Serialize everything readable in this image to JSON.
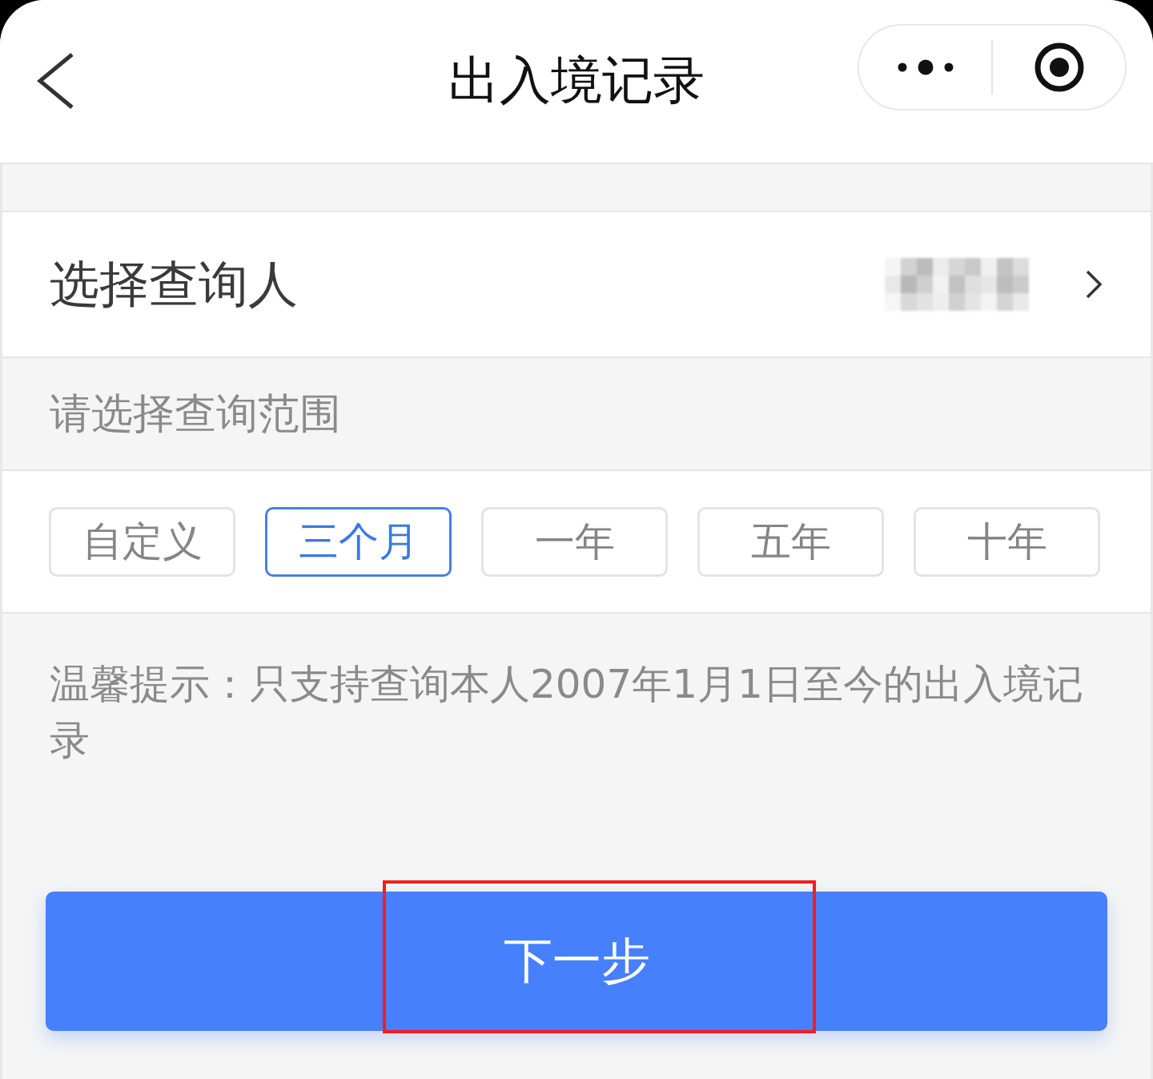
{
  "header": {
    "title": "出入境记录"
  },
  "query_person": {
    "label": "选择查询人",
    "value_obscured": true
  },
  "range": {
    "heading": "请选择查询范围",
    "options": [
      {
        "label": "自定义",
        "selected": false
      },
      {
        "label": "三个月",
        "selected": true
      },
      {
        "label": "一年",
        "selected": false
      },
      {
        "label": "五年",
        "selected": false
      },
      {
        "label": "十年",
        "selected": false
      }
    ]
  },
  "tip": "温馨提示：只支持查询本人2007年1月1日至今的出入境记录",
  "next_button": {
    "label": "下一步",
    "highlighted": true
  }
}
